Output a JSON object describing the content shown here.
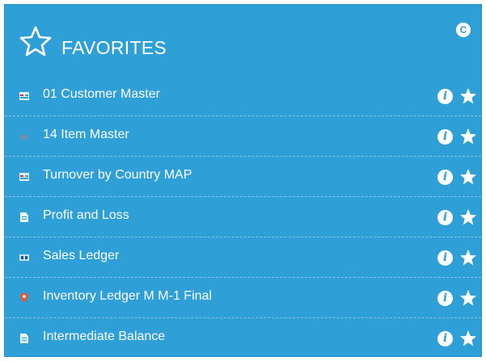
{
  "header": {
    "title": "FAVORITES",
    "collapse_glyph": "C"
  },
  "items": [
    {
      "label": "01 Customer Master",
      "icon": "table-icon"
    },
    {
      "label": "14 Item Master",
      "icon": "binoculars-icon"
    },
    {
      "label": "Turnover by Country MAP",
      "icon": "table-icon"
    },
    {
      "label": "Profit and Loss",
      "icon": "document-icon"
    },
    {
      "label": "Sales Ledger",
      "icon": "ledger-icon"
    },
    {
      "label": "Inventory Ledger M M-1 Final",
      "icon": "map-pin-icon"
    },
    {
      "label": "Intermediate Balance",
      "icon": "document-icon"
    }
  ],
  "info_glyph": "i",
  "colors": {
    "panel": "#2f9fd8",
    "text": "#ffffff",
    "pin": "#e05a3a"
  }
}
